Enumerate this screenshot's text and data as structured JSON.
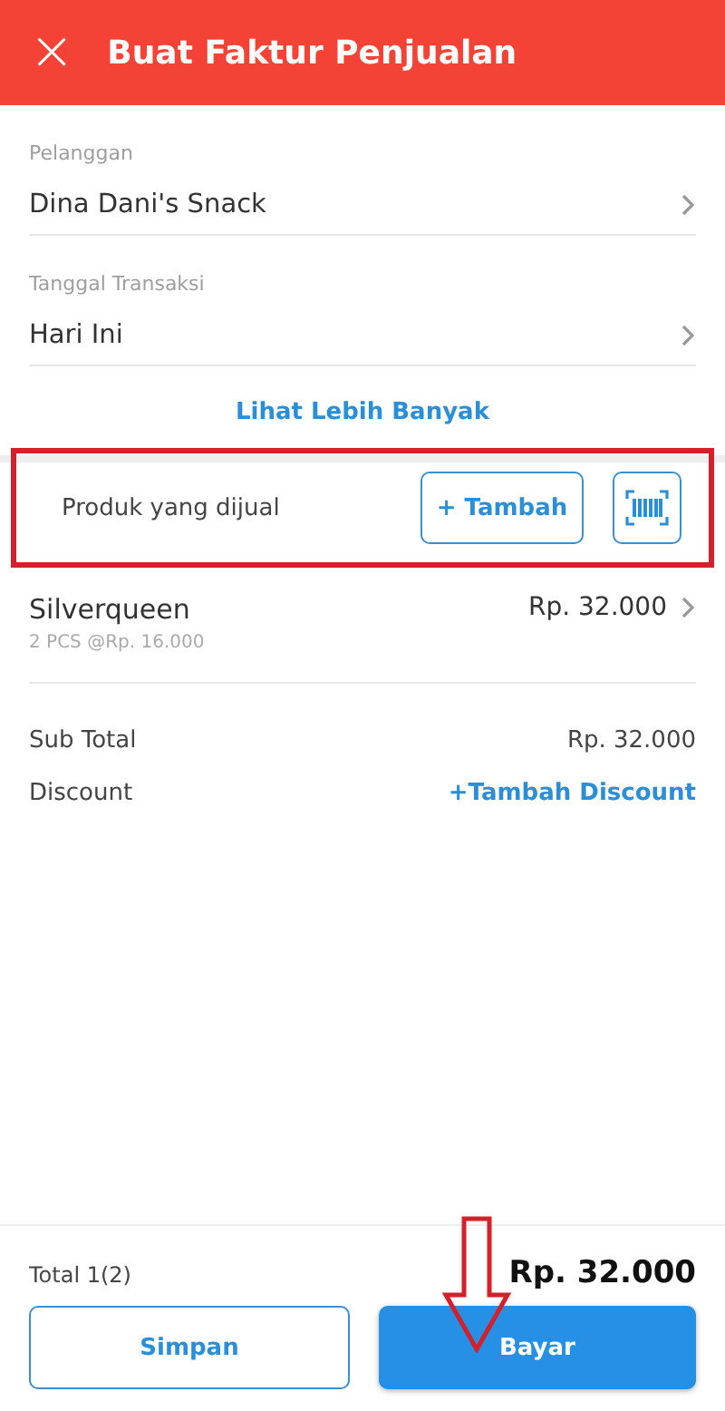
{
  "header": {
    "close": "×",
    "title": "Buat Faktur Penjualan"
  },
  "fields": [
    {
      "label": "Pelanggan",
      "value": "Dina Dani's Snack"
    },
    {
      "label": "Tanggal Transaksi",
      "value": "Hari Ini"
    }
  ],
  "more_link": "Lihat Lebih Banyak",
  "products_section": {
    "label": "Produk yang dijual",
    "add_button": "+ Tambah",
    "highlighted": true
  },
  "products": [
    {
      "name": "Silverqueen",
      "detail": "2 PCS @Rp. 16.000",
      "price": "Rp. 32.000"
    }
  ],
  "summary": [
    {
      "label": "Sub Total",
      "value": "Rp. 32.000",
      "kind": "text"
    },
    {
      "label": "Discount",
      "value": "+Tambah Discount",
      "kind": "link"
    }
  ],
  "footer": {
    "total_label": "Total 1(2)",
    "total_value": "Rp. 32.000",
    "save_button": "Simpan",
    "pay_button": "Bayar",
    "pay_arrow": true
  }
}
